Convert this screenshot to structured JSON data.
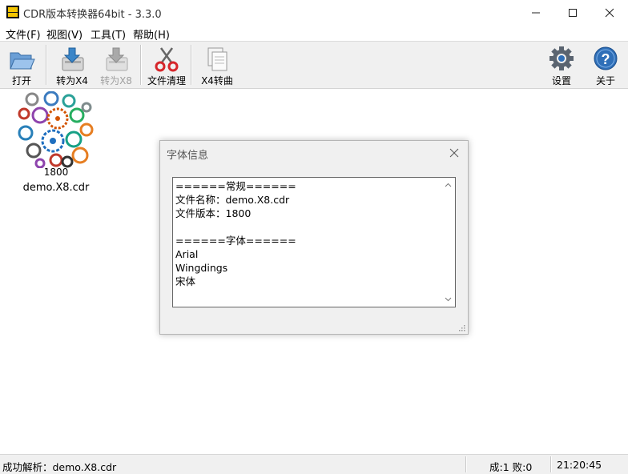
{
  "window": {
    "title": "CDR版本转换器64bit - 3.3.0",
    "app_icon_text": "CDR Version"
  },
  "menu": [
    {
      "label": "文件(F)"
    },
    {
      "label": "视图(V)"
    },
    {
      "label": "工具(T)"
    },
    {
      "label": "帮助(H)"
    }
  ],
  "toolbar": {
    "open": "打开",
    "to_x4": "转为X4",
    "to_x8": "转为X8",
    "clean": "文件清理",
    "x4_curve": "X4转曲",
    "settings": "设置",
    "about": "关于"
  },
  "file_item": {
    "version": "1800",
    "name": "demo.X8.cdr"
  },
  "dialog": {
    "title": "字体信息",
    "lines": [
      "======常规======",
      "文件名称：demo.X8.cdr",
      "文件版本：1800",
      "",
      "======字体======",
      "Arial",
      "Wingdings",
      "宋体"
    ]
  },
  "status": {
    "message": "成功解析：demo.X8.cdr",
    "counts": "成:1 败:0",
    "time": "21:20:45"
  },
  "colors": {
    "accent_blue": "#2f6fb8",
    "toolbar_bg": "#f0f0f0",
    "disabled_text": "#a0a0a0"
  }
}
